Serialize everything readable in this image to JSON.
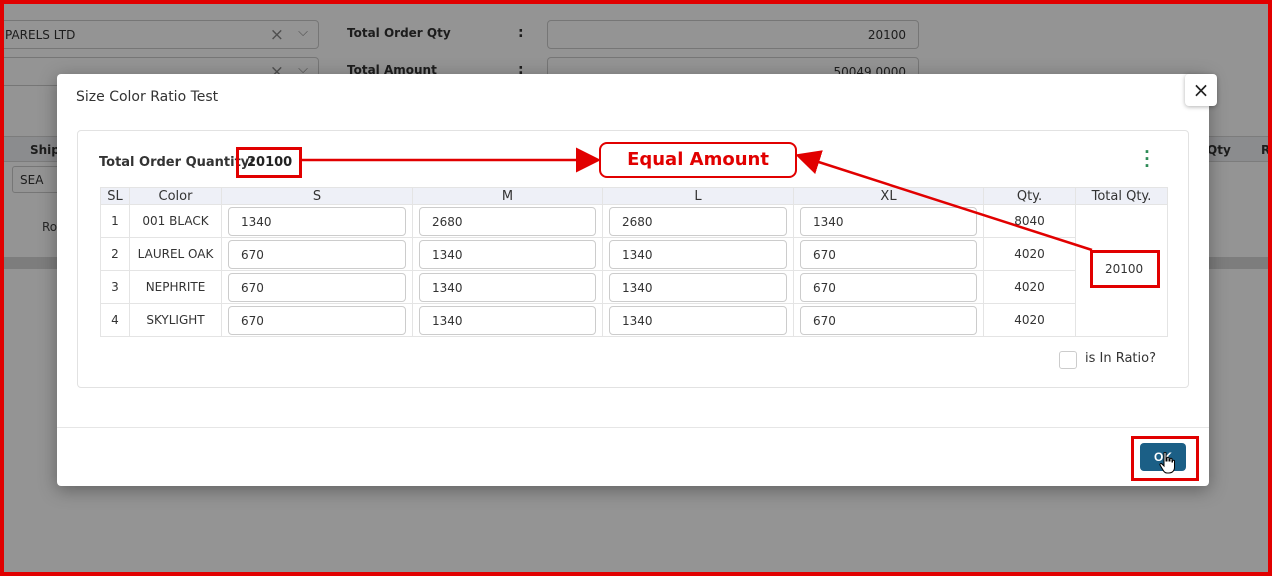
{
  "background": {
    "buyer_select": "PARELS LTD",
    "total_order_qty_label": "Total Order Qty",
    "total_order_qty_colon": ":",
    "total_order_qty_value": "20100",
    "total_amount_label": "Total Amount",
    "total_amount_colon": ":",
    "total_amount_value": "50049.0000",
    "table_headers": [
      "Shipr",
      "Qty",
      "R"
    ],
    "ship_mode": "SEA",
    "row_text": "Ro"
  },
  "modal": {
    "title": "Size Color Ratio Test",
    "close_icon": "×",
    "total_order_quantity_label": "Total Order Quantity:",
    "total_order_quantity_value": "20100",
    "columns": [
      "SL",
      "Color",
      "S",
      "M",
      "L",
      "XL",
      "Qty.",
      "Total Qty."
    ],
    "rows": [
      {
        "sl": "1",
        "color": "001 BLACK",
        "s": "1340",
        "m": "2680",
        "l": "2680",
        "xl": "1340",
        "qty": "8040"
      },
      {
        "sl": "2",
        "color": "LAUREL OAK",
        "s": "670",
        "m": "1340",
        "l": "1340",
        "xl": "670",
        "qty": "4020"
      },
      {
        "sl": "3",
        "color": "NEPHRITE",
        "s": "670",
        "m": "1340",
        "l": "1340",
        "xl": "670",
        "qty": "4020"
      },
      {
        "sl": "4",
        "color": "SKYLIGHT",
        "s": "670",
        "m": "1340",
        "l": "1340",
        "xl": "670",
        "qty": "4020"
      }
    ],
    "total_qty": "20100",
    "is_in_ratio_label": "is In Ratio?",
    "is_in_ratio_checked": false,
    "ok_label": "OK"
  },
  "annotation": {
    "callout_text": "Equal Amount",
    "color": "#e10000"
  },
  "colors": {
    "primary_button": "#1b5f86",
    "kebab": "#2e8b57",
    "header_bg": "#eef0f7"
  }
}
